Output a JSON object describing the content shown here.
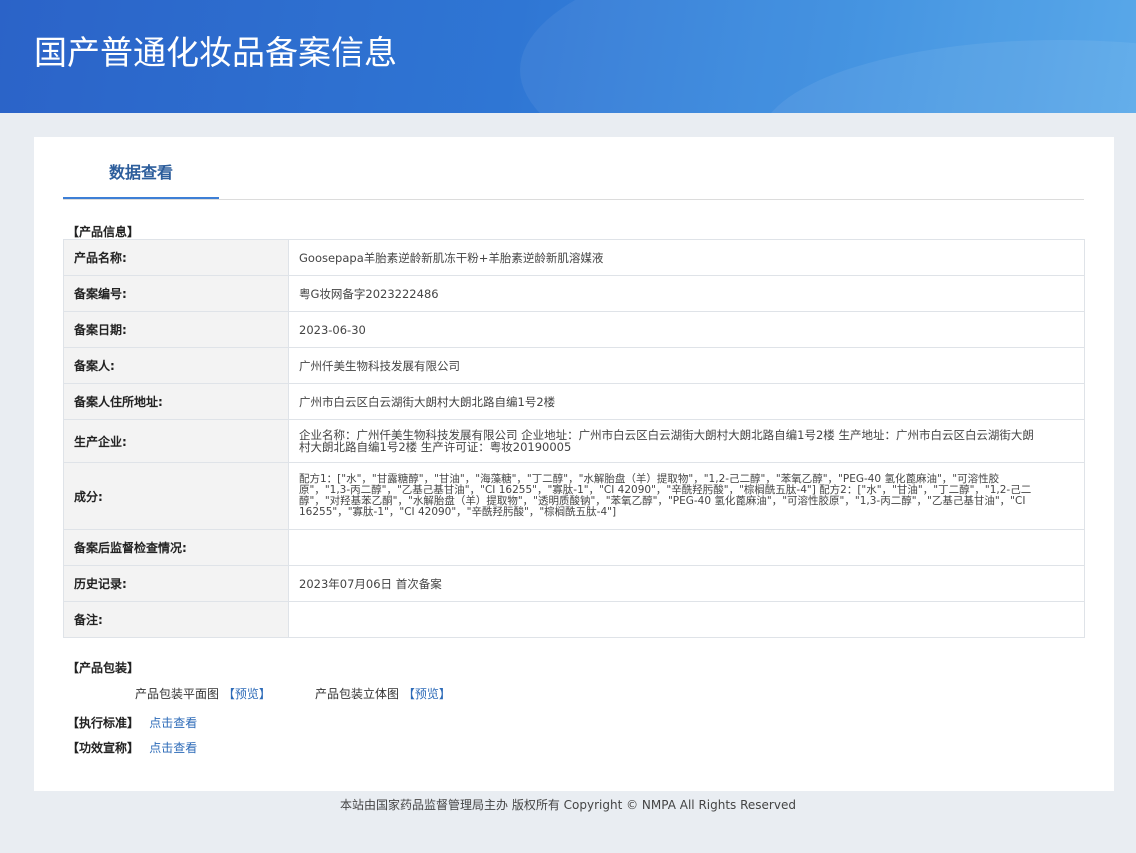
{
  "banner": {
    "title": "国产普通化妆品备案信息"
  },
  "tabs": [
    {
      "label": "数据查看"
    }
  ],
  "sections": {
    "product_info": "【产品信息】",
    "packaging": "【产品包装】",
    "standard": "【执行标准】",
    "efficacy": "【功效宣称】"
  },
  "info_rows": [
    {
      "label": "产品名称:",
      "value": "Goosepapa羊胎素逆龄新肌冻干粉+羊胎素逆龄新肌溶媒液"
    },
    {
      "label": "备案编号:",
      "value": "粤G妆网备字2023222486"
    },
    {
      "label": "备案日期:",
      "value": "2023-06-30"
    },
    {
      "label": "备案人:",
      "value": "广州仟美生物科技发展有限公司"
    },
    {
      "label": "备案人住所地址:",
      "value": "广州市白云区白云湖街大朗村大朗北路自编1号2楼"
    },
    {
      "label": "生产企业:",
      "value": "企业名称：广州仟美生物科技发展有限公司 企业地址：广州市白云区白云湖街大朗村大朗北路自编1号2楼 生产地址：广州市白云区白云湖街大朗村大朗北路自编1号2楼 生产许可证：粤妆20190005"
    },
    {
      "label": "成分:",
      "value": "配方1：[\"水\"，\"甘露糖醇\"，\"甘油\"，\"海藻糖\"，\"丁二醇\"，\"水解胎盘（羊）提取物\"，\"1,2-己二醇\"，\"苯氧乙醇\"，\"PEG-40 氢化蓖麻油\"，\"可溶性胶原\"，\"1,3-丙二醇\"，\"乙基己基甘油\"，\"CI 16255\"，\"寡肽-1\"，\"CI 42090\"，\"辛酰羟肟酸\"，\"棕榈酰五肽-4\"] 配方2：[\"水\"，\"甘油\"，\"丁二醇\"，\"1,2-己二醇\"，\"对羟基苯乙酮\"，\"水解胎盘（羊）提取物\"，\"透明质酸钠\"，\"苯氧乙醇\"，\"PEG-40 氢化蓖麻油\"，\"可溶性胶原\"，\"1,3-丙二醇\"，\"乙基己基甘油\"，\"CI 16255\"，\"寡肽-1\"，\"CI 42090\"，\"辛酰羟肟酸\"，\"棕榈酰五肽-4\"]"
    },
    {
      "label": "备案后监督检查情况:",
      "value": ""
    },
    {
      "label": "历史记录:",
      "value": "2023年07月06日 首次备案"
    },
    {
      "label": "备注:",
      "value": ""
    }
  ],
  "packaging": {
    "flat_label": "产品包装平面图",
    "flat_link": "【预览】",
    "solid_label": "产品包装立体图",
    "solid_link": "【预览】"
  },
  "links": {
    "standard": "点击查看",
    "efficacy": "点击查看"
  },
  "footer": {
    "text": "本站由国家药品监督管理局主办 版权所有 Copyright © NMPA All Rights Reserved"
  }
}
